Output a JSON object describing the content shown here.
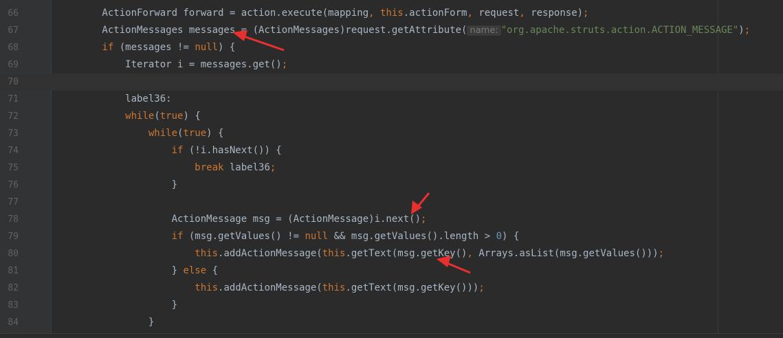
{
  "editor": {
    "lines": [
      {
        "num": "66",
        "segs": [
          [
            "t",
            "        ActionForward forward = action.execute(mapping"
          ],
          [
            "p",
            ", "
          ],
          [
            "k",
            "this"
          ],
          [
            "t",
            ".actionForm"
          ],
          [
            "p",
            ", "
          ],
          [
            "t",
            "request"
          ],
          [
            "p",
            ", "
          ],
          [
            "t",
            "response)"
          ],
          [
            "p",
            ";"
          ]
        ]
      },
      {
        "num": "67",
        "segs": [
          [
            "t",
            "        ActionMessages messages = (ActionMessages)request.getAttribute("
          ],
          [
            "h",
            "name:"
          ],
          [
            "s",
            "\"org.apache.struts.action.ACTION_MESSAGE\""
          ],
          [
            "t",
            ")"
          ],
          [
            "p",
            ";"
          ]
        ]
      },
      {
        "num": "68",
        "segs": [
          [
            "t",
            "        "
          ],
          [
            "k",
            "if"
          ],
          [
            "t",
            " (messages != "
          ],
          [
            "k",
            "null"
          ],
          [
            "t",
            ") {"
          ]
        ]
      },
      {
        "num": "69",
        "segs": [
          [
            "t",
            "            Iterator i = messages.get()"
          ],
          [
            "p",
            ";"
          ]
        ]
      },
      {
        "num": "70",
        "segs": [],
        "current": true
      },
      {
        "num": "71",
        "segs": [
          [
            "t",
            "            label36:"
          ]
        ]
      },
      {
        "num": "72",
        "segs": [
          [
            "t",
            "            "
          ],
          [
            "k",
            "while"
          ],
          [
            "t",
            "("
          ],
          [
            "k",
            "true"
          ],
          [
            "t",
            ") {"
          ]
        ]
      },
      {
        "num": "73",
        "segs": [
          [
            "t",
            "                "
          ],
          [
            "k",
            "while"
          ],
          [
            "t",
            "("
          ],
          [
            "k",
            "true"
          ],
          [
            "t",
            ") {"
          ]
        ]
      },
      {
        "num": "74",
        "segs": [
          [
            "t",
            "                    "
          ],
          [
            "k",
            "if"
          ],
          [
            "t",
            " (!i.hasNext()) {"
          ]
        ]
      },
      {
        "num": "75",
        "segs": [
          [
            "t",
            "                        "
          ],
          [
            "k",
            "break"
          ],
          [
            "t",
            " label36"
          ],
          [
            "p",
            ";"
          ]
        ]
      },
      {
        "num": "76",
        "segs": [
          [
            "t",
            "                    }"
          ]
        ]
      },
      {
        "num": "77",
        "segs": []
      },
      {
        "num": "78",
        "segs": [
          [
            "t",
            "                    ActionMessage msg = (ActionMessage)i.next()"
          ],
          [
            "p",
            ";"
          ]
        ]
      },
      {
        "num": "79",
        "segs": [
          [
            "t",
            "                    "
          ],
          [
            "k",
            "if"
          ],
          [
            "t",
            " (msg.getValues() != "
          ],
          [
            "k",
            "null"
          ],
          [
            "t",
            " && msg.getValues().length > "
          ],
          [
            "n",
            "0"
          ],
          [
            "t",
            ") {"
          ]
        ]
      },
      {
        "num": "80",
        "segs": [
          [
            "t",
            "                        "
          ],
          [
            "k",
            "this"
          ],
          [
            "t",
            ".addActionMessage("
          ],
          [
            "k",
            "this"
          ],
          [
            "t",
            ".getText(msg.getKey()"
          ],
          [
            "p",
            ", "
          ],
          [
            "t",
            "Arrays.asList(msg.getValues()))"
          ],
          [
            "p",
            ";"
          ]
        ]
      },
      {
        "num": "81",
        "segs": [
          [
            "t",
            "                    } "
          ],
          [
            "k",
            "else"
          ],
          [
            "t",
            " {"
          ]
        ]
      },
      {
        "num": "82",
        "segs": [
          [
            "t",
            "                        "
          ],
          [
            "k",
            "this"
          ],
          [
            "t",
            ".addActionMessage("
          ],
          [
            "k",
            "this"
          ],
          [
            "t",
            ".getText(msg.getKey()))"
          ],
          [
            "p",
            ";"
          ]
        ]
      },
      {
        "num": "83",
        "segs": [
          [
            "t",
            "                    }"
          ]
        ]
      },
      {
        "num": "84",
        "segs": [
          [
            "t",
            "                }"
          ]
        ]
      }
    ]
  },
  "colors": {
    "background": "#2b2b2b",
    "keyword": "#cc7832",
    "string": "#6a8759",
    "number": "#6897bb",
    "text": "#a9b7c6",
    "annotation_arrow": "#e8312f"
  }
}
